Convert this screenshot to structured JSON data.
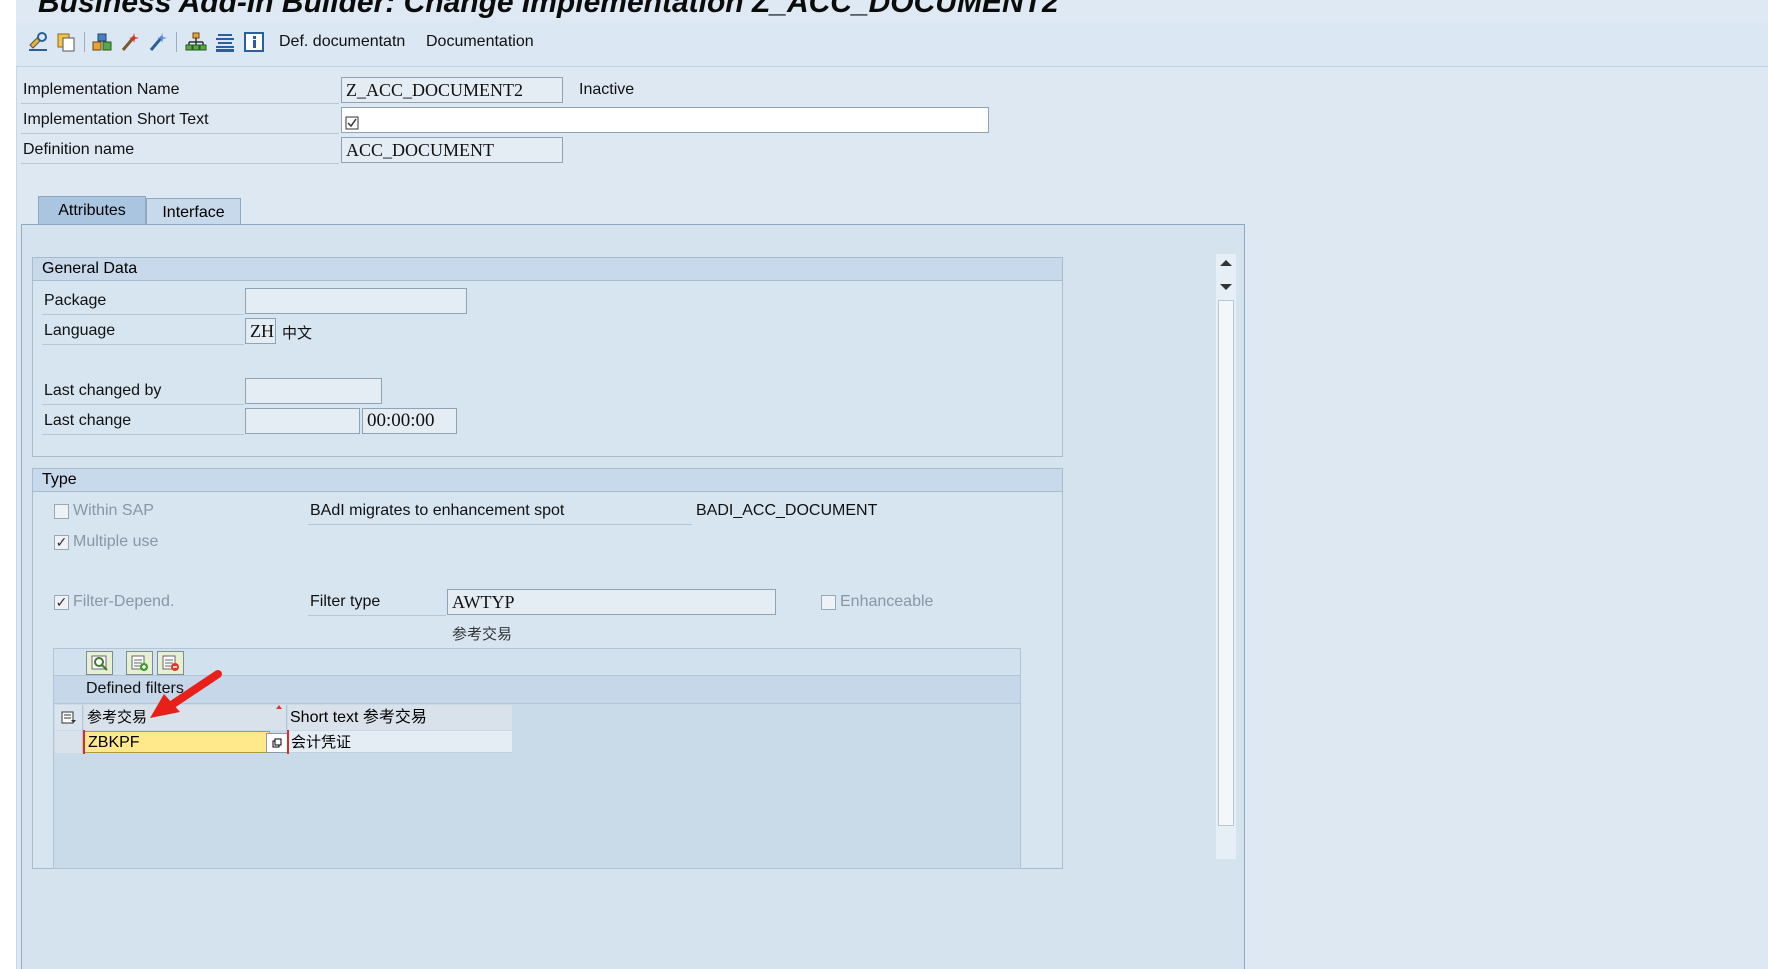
{
  "window": {
    "title": "Business Add-In Builder: Change Implementation Z_ACC_DOCUMENT2"
  },
  "toolbar": {
    "icons": [
      "display-change-icon",
      "copy-object-icon",
      "object-list-icon",
      "activate-icon",
      "check-icon",
      "hierarchy-icon",
      "list-icon",
      "info-icon"
    ],
    "def_documentation_label": "Def. documentatn",
    "documentation_label": "Documentation"
  },
  "header": {
    "impl_name_label": "Implementation Name",
    "impl_name_value": "Z_ACC_DOCUMENT2",
    "status": "Inactive",
    "short_text_label": "Implementation Short Text",
    "short_text_value": "",
    "def_name_label": "Definition name",
    "def_name_value": "ACC_DOCUMENT"
  },
  "tabs": [
    {
      "label": "Attributes",
      "active": true
    },
    {
      "label": "Interface",
      "active": false
    }
  ],
  "general_data": {
    "title": "General Data",
    "package_label": "Package",
    "package_value": "",
    "language_label": "Language",
    "language_code": "ZH",
    "language_name": "中文",
    "last_changed_by_label": "Last changed by",
    "last_changed_by_value": "",
    "last_change_label": "Last change",
    "last_change_date": "",
    "last_change_time": "00:00:00"
  },
  "type_group": {
    "title": "Type",
    "within_sap_label": "Within SAP",
    "within_sap_checked": false,
    "multiple_use_label": "Multiple use",
    "multiple_use_checked": true,
    "migrates_label": "BAdI migrates to enhancement spot",
    "migrates_value": "BADI_ACC_DOCUMENT",
    "filter_depend_label": "Filter-Depend.",
    "filter_depend_checked": true,
    "filter_type_label": "Filter type",
    "filter_type_value": "AWTYP",
    "filter_type_desc": "参考交易",
    "enhanceable_label": "Enhanceable",
    "enhanceable_checked": false
  },
  "defined_filters": {
    "title": "Defined filters",
    "columns": [
      "参考交易",
      "Short text 参考交易"
    ],
    "rows": [
      {
        "value": "ZBKPF",
        "text": "会计凭证"
      }
    ]
  },
  "colors": {
    "background": "#dde8f2",
    "highlight_cell": "#ffe98a",
    "annotation_arrow": "#e8201a"
  }
}
